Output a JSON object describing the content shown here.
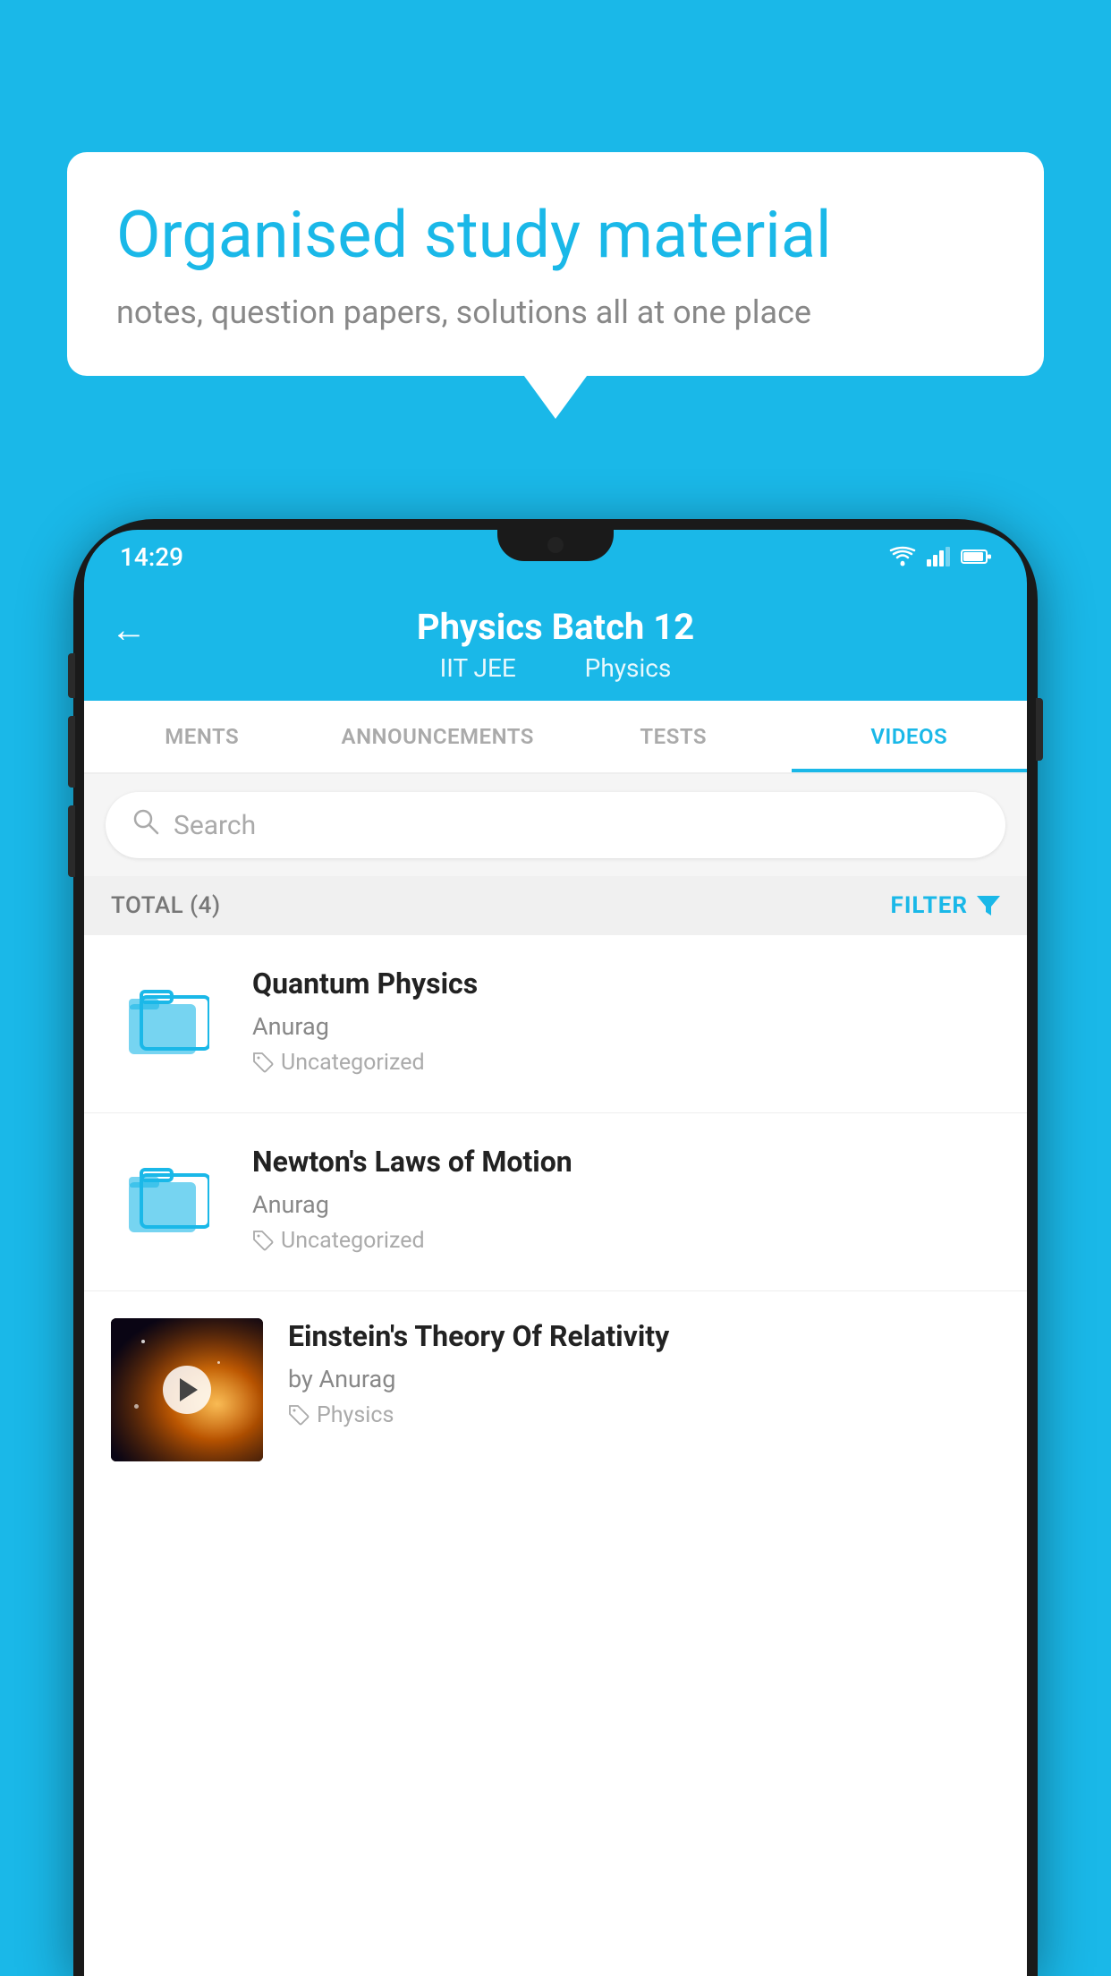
{
  "background_color": "#1ab8e8",
  "speech_bubble": {
    "title": "Organised study material",
    "subtitle": "notes, question papers, solutions all at one place"
  },
  "phone": {
    "status_bar": {
      "time": "14:29"
    },
    "header": {
      "back_label": "←",
      "title": "Physics Batch 12",
      "subtitle_part1": "IIT JEE",
      "subtitle_part2": "Physics"
    },
    "tabs": [
      {
        "label": "MENTS",
        "active": false
      },
      {
        "label": "ANNOUNCEMENTS",
        "active": false
      },
      {
        "label": "TESTS",
        "active": false
      },
      {
        "label": "VIDEOS",
        "active": true
      }
    ],
    "search": {
      "placeholder": "Search"
    },
    "filter": {
      "total_label": "TOTAL (4)",
      "filter_label": "FILTER"
    },
    "videos": [
      {
        "title": "Quantum Physics",
        "author": "Anurag",
        "tag": "Uncategorized",
        "has_thumb": false
      },
      {
        "title": "Newton's Laws of Motion",
        "author": "Anurag",
        "tag": "Uncategorized",
        "has_thumb": false
      },
      {
        "title": "Einstein's Theory Of Relativity",
        "author": "by Anurag",
        "tag": "Physics",
        "has_thumb": true
      }
    ]
  }
}
